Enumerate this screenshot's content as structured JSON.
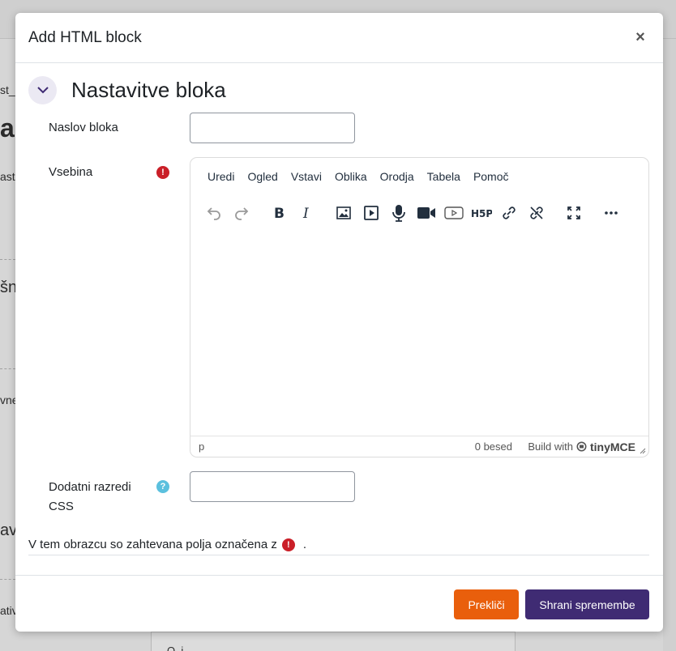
{
  "background": {
    "fragments": [
      "st_",
      "a",
      "ast",
      "šn",
      "vne",
      "av",
      "ativ",
      "O..i..."
    ]
  },
  "modal": {
    "title": "Add HTML block",
    "close_label": "×",
    "section_title": "Nastavitve bloka",
    "fields": {
      "title_label": "Naslov bloka",
      "title_value": "",
      "content_label": "Vsebina",
      "css_label_line1": "Dodatni razredi",
      "css_label_line2": "CSS",
      "css_value": ""
    },
    "editor": {
      "menu": [
        "Uredi",
        "Ogled",
        "Vstavi",
        "Oblika",
        "Orodja",
        "Tabela",
        "Pomoč"
      ],
      "toolbar_icons": [
        "undo-icon",
        "redo-icon",
        "bold-icon",
        "italic-icon",
        "image-icon",
        "media-icon",
        "microphone-icon",
        "video-camera-icon",
        "video-embed-icon",
        "h5p-icon",
        "link-icon",
        "unlink-icon",
        "fullscreen-icon",
        "more-icon"
      ],
      "status_path": "p",
      "word_count": "0 besed",
      "brand_prefix": "Build with",
      "brand_name": "tinyMCE"
    },
    "required_note": "V tem obrazcu so zahtevana polja označena z",
    "required_note_end": ".",
    "buttons": {
      "cancel": "Prekliči",
      "save": "Shrani spremembe"
    },
    "colors": {
      "cancel": "#e95f0c",
      "save": "#3f2b73",
      "required": "#ca1f28",
      "help": "#5bc0de"
    }
  }
}
